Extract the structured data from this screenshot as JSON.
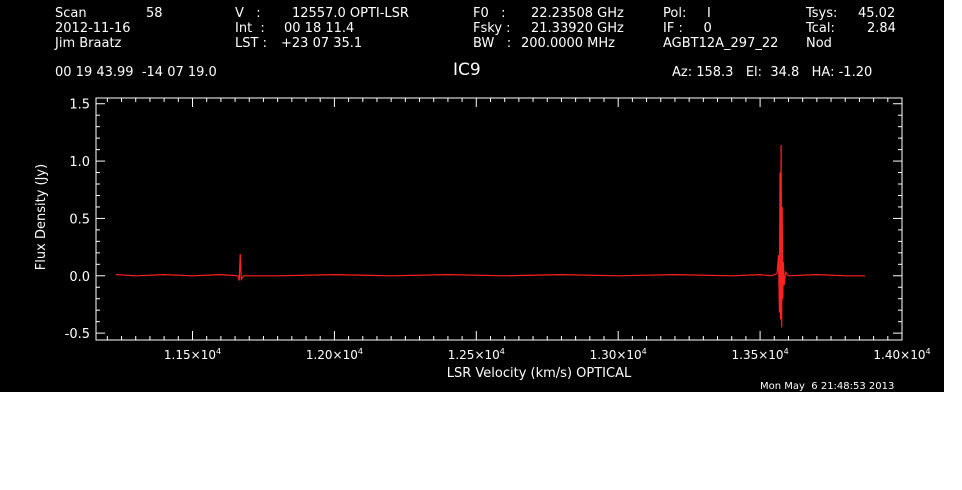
{
  "header": {
    "col1": [
      "Scan",
      "2012-11-16",
      "Jim Braatz"
    ],
    "scan_number": "58",
    "col2_labels": [
      "V   :",
      "Int  :",
      "LST : "
    ],
    "col2_values": [
      "12557.0 OPTI-LSR",
      "00 18 11.4",
      "+23 07 35.1"
    ],
    "col3_labels": [
      "F0   :",
      "Fsky :",
      "BW   :"
    ],
    "col3_values": [
      "22.23508 GHz",
      "21.33920 GHz",
      "200.0000 MHz"
    ],
    "col4": [
      "Pol:     I",
      "IF :     0",
      "AGBT12A_297_22"
    ],
    "col5_labels": [
      "Tsys:",
      "Tcal:",
      "Nod"
    ],
    "col5_values": [
      "45.02",
      "2.84",
      ""
    ],
    "coords": "00 19 43.99  -14 07 19.0",
    "source": "IC9",
    "az_el_ha": "Az: 158.3   El:  34.8   HA: -1.20",
    "timestamp": "Mon May  6 21:48:53 2013"
  },
  "colors": {
    "background": "#000000",
    "axes": "#ffffff",
    "spectrum": "#ff2020"
  },
  "chart_data": {
    "type": "line",
    "title": "IC9",
    "xlabel": "LSR Velocity (km/s) OPTICAL",
    "ylabel": "Flux Density (Jy)",
    "xlim": [
      11160,
      14000
    ],
    "ylim": [
      -0.56,
      1.55
    ],
    "x_ticks": [
      11500,
      12000,
      12500,
      13000,
      13500,
      14000
    ],
    "x_tick_labels": [
      "1.15×10",
      "1.20×10",
      "1.25×10",
      "1.30×10",
      "1.35×10",
      "1.40×10"
    ],
    "x_tick_exponent": "4",
    "y_ticks": [
      -0.5,
      0.0,
      0.5,
      1.0,
      1.5
    ],
    "y_tick_labels": [
      "-0.5",
      "0.0",
      "0.5",
      "1.0",
      "1.5"
    ],
    "series": [
      {
        "x": [
          11230,
          11300,
          11400,
          11500,
          11600,
          11660,
          11665,
          11668,
          11672,
          11680,
          11800,
          12000,
          12200,
          12400,
          12600,
          12800,
          13000,
          13200,
          13400,
          13500,
          13540,
          13560,
          13565,
          13568,
          13570,
          13572,
          13574,
          13576,
          13578,
          13580,
          13582,
          13585,
          13590,
          13600,
          13700,
          13800,
          13870
        ],
        "y": [
          0.01,
          0.0,
          0.01,
          0.0,
          0.01,
          0.0,
          -0.04,
          0.19,
          -0.03,
          0.0,
          0.0,
          0.01,
          0.0,
          0.01,
          0.0,
          0.01,
          0.0,
          0.01,
          0.0,
          0.01,
          0.0,
          0.02,
          0.18,
          -0.32,
          0.9,
          -0.38,
          1.14,
          -0.45,
          0.6,
          -0.2,
          0.12,
          -0.08,
          0.03,
          0.0,
          0.01,
          0.0,
          0.0
        ]
      }
    ],
    "grid": false
  }
}
